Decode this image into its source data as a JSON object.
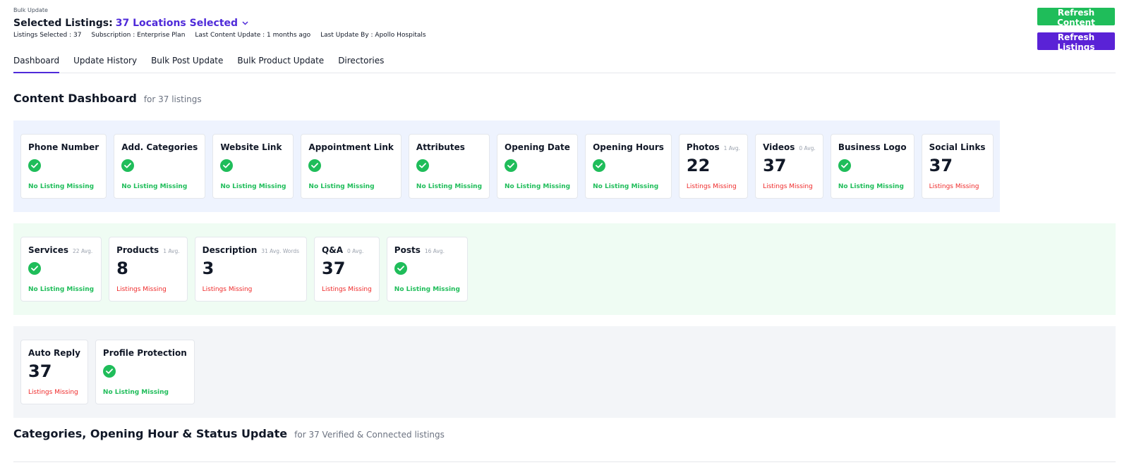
{
  "header": {
    "breadcrumb": "Bulk Update",
    "title_prefix": "Selected Listings:",
    "title_selection": "37 Locations Selected",
    "meta": {
      "listings_selected": "Listings Selected : 37",
      "subscription": "Subscription : Enterprise Plan",
      "last_content_update": "Last Content Update : 1 months ago",
      "last_update_by": "Last Update By : Apollo Hospitals"
    }
  },
  "buttons": {
    "refresh_content": "Refresh Content",
    "refresh_listings": "Refresh Listings"
  },
  "tabs": [
    "Dashboard",
    "Update History",
    "Bulk Post Update",
    "Bulk Product Update",
    "Directories"
  ],
  "content_dashboard": {
    "title": "Content Dashboard",
    "subtitle": "for 37 listings"
  },
  "status_labels": {
    "ok": "No Listing Missing",
    "missing": "Listings Missing"
  },
  "row1": [
    {
      "title": "Phone Number",
      "avg": "",
      "value": "",
      "status": "No Listing Missing",
      "ok": true
    },
    {
      "title": "Add. Categories",
      "avg": "",
      "value": "",
      "status": "No Listing Missing",
      "ok": true
    },
    {
      "title": "Website Link",
      "avg": "",
      "value": "",
      "status": "No Listing Missing",
      "ok": true
    },
    {
      "title": "Appointment Link",
      "avg": "",
      "value": "",
      "status": "No Listing Missing",
      "ok": true
    },
    {
      "title": "Attributes",
      "avg": "",
      "value": "",
      "status": "No Listing Missing",
      "ok": true
    },
    {
      "title": "Opening Date",
      "avg": "",
      "value": "",
      "status": "No Listing Missing",
      "ok": true
    },
    {
      "title": "Opening Hours",
      "avg": "",
      "value": "",
      "status": "No Listing Missing",
      "ok": true
    },
    {
      "title": "Photos",
      "avg": "1 Avg.",
      "value": "22",
      "status": "Listings Missing",
      "ok": false
    },
    {
      "title": "Videos",
      "avg": "0 Avg.",
      "value": "37",
      "status": "Listings Missing",
      "ok": false
    },
    {
      "title": "Business Logo",
      "avg": "",
      "value": "",
      "status": "No Listing Missing",
      "ok": true
    },
    {
      "title": "Social Links",
      "avg": "",
      "value": "37",
      "status": "Listings Missing",
      "ok": false
    }
  ],
  "row2": [
    {
      "title": "Services",
      "avg": "22 Avg.",
      "value": "",
      "status": "No Listing Missing",
      "ok": true
    },
    {
      "title": "Products",
      "avg": "1 Avg.",
      "value": "8",
      "status": "Listings Missing",
      "ok": false
    },
    {
      "title": "Description",
      "avg": "31 Avg. Words",
      "value": "3",
      "status": "Listings Missing",
      "ok": false
    },
    {
      "title": "Q&A",
      "avg": "0 Avg.",
      "value": "37",
      "status": "Listings Missing",
      "ok": false
    },
    {
      "title": "Posts",
      "avg": "16 Avg.",
      "value": "",
      "status": "No Listing Missing",
      "ok": true
    }
  ],
  "row3": [
    {
      "title": "Auto Reply",
      "avg": "",
      "value": "37",
      "status": "Listings Missing",
      "ok": false
    },
    {
      "title": "Profile Protection",
      "avg": "",
      "value": "",
      "status": "No Listing Missing",
      "ok": true
    }
  ],
  "categories_section": {
    "title": "Categories, Opening Hour & Status Update",
    "subtitle": "for 37 Verified & Connected listings"
  },
  "colors": {
    "accent_purple": "#4f2bd9",
    "success_green": "#1fbd5a",
    "danger_red": "#ef2a2a"
  }
}
